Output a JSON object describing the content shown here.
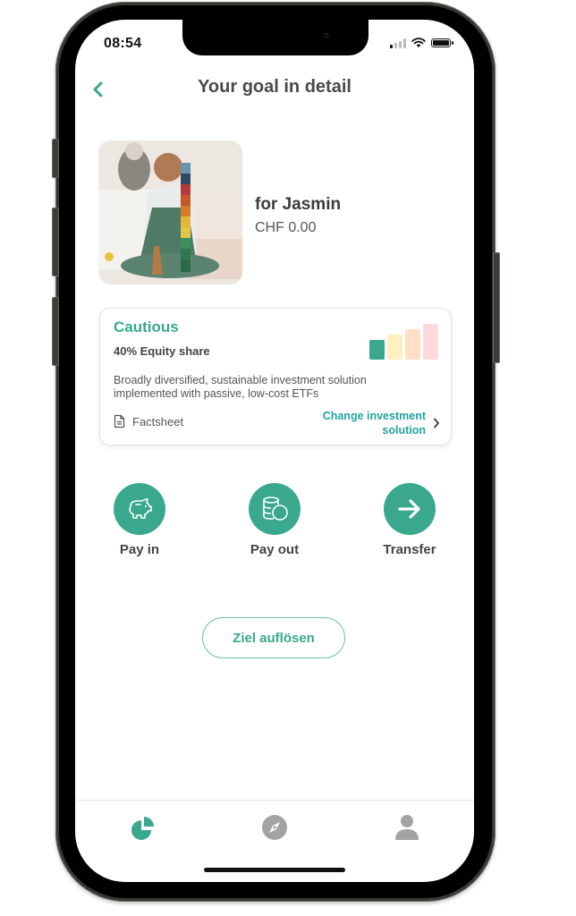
{
  "status_bar": {
    "time": "08:54"
  },
  "header": {
    "title": "Your goal in detail",
    "back_icon": "chevron-left-icon"
  },
  "goal": {
    "name": "for Jasmin",
    "amount": "CHF 0.00",
    "image": "child-stacking-blocks-photo"
  },
  "strategy_card": {
    "title": "Cautious",
    "equity": "40% Equity share",
    "description": "Broadly diversified, sustainable investment solution implemented with passive, low-cost ETFs",
    "factsheet_label": "Factsheet",
    "change_label_line1": "Change investment",
    "change_label_line2": "solution",
    "risk_level": 1,
    "risk_levels_total": 4,
    "risk_colors": [
      "#3aa88c",
      "#fff1bf",
      "#ffdfc6",
      "#ffdadd"
    ]
  },
  "actions": [
    {
      "label": "Pay in",
      "icon": "piggy-bank-icon"
    },
    {
      "label": "Pay out",
      "icon": "coins-icon"
    },
    {
      "label": "Transfer",
      "icon": "arrow-right-icon"
    }
  ],
  "dissolve_button": {
    "label": "Ziel auflösen"
  },
  "tabbar": [
    {
      "name": "portfolio",
      "icon": "pie-chart-icon",
      "active": true
    },
    {
      "name": "explore",
      "icon": "compass-icon",
      "active": false
    },
    {
      "name": "profile",
      "icon": "person-icon",
      "active": false
    }
  ],
  "colors": {
    "accent": "#3aa88c",
    "link": "#22a3a0",
    "inactive_icon": "#a3a3a3"
  }
}
